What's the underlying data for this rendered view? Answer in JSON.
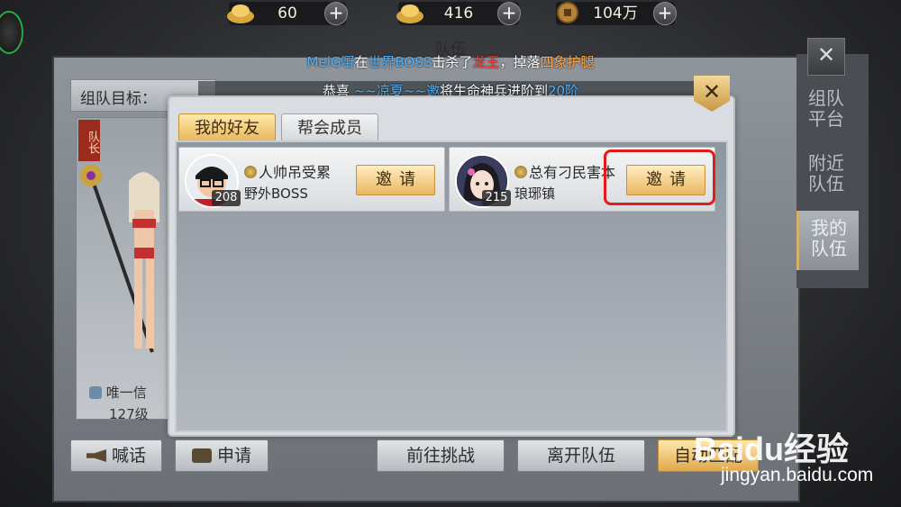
{
  "currency": [
    {
      "icon": "gold-ingot-icon",
      "value": "60"
    },
    {
      "icon": "gold-ingot-icon",
      "value": "416"
    },
    {
      "icon": "copper-coin-icon",
      "value": "104万"
    }
  ],
  "back_window": {
    "title": "队伍",
    "goal_label": "组队目标：",
    "leader_badge": "队长",
    "member_name": "唯一信",
    "member_level": "127级",
    "side_tabs": [
      "组队平台",
      "附近队伍",
      "我的队伍"
    ]
  },
  "notices": {
    "line1": {
      "player": "MeiG嘢",
      "t1": "在",
      "place": "世界BOSS",
      "t2": "击杀了",
      "boss": "龙王",
      "t3": "，掉落",
      "item": "四象护腿"
    },
    "line2": {
      "t1": "恭喜",
      "player": "~~凉夏~~邀",
      "t2": "将生命神兵进阶到",
      "level": "20阶"
    }
  },
  "dialog": {
    "tabs": [
      "我的好友",
      "帮会成员"
    ],
    "friends": [
      {
        "name": "人帅吊受累",
        "level": "208",
        "location": "野外BOSS",
        "button": "邀请"
      },
      {
        "name": "总有刁民害本",
        "level": "215",
        "location": "琅琊镇",
        "button": "邀请"
      }
    ]
  },
  "bottom_buttons": {
    "shout": "喊话",
    "apply": "申请",
    "challenge": "前往挑战",
    "leave": "离开队伍",
    "auto": "自动匹配"
  },
  "watermark": {
    "brand": "Baidu经验",
    "url": "jingyan.baidu.com"
  },
  "colors": {
    "accent_gold": "#e7b356",
    "highlight_red": "#e21b1b",
    "notice_blue": "#4fb4ff",
    "notice_red": "#ff4040",
    "notice_orange": "#ffa84a"
  }
}
